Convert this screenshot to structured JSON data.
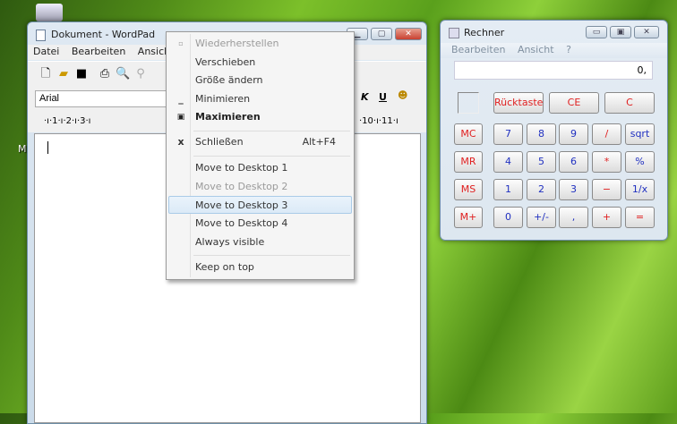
{
  "desktop": {
    "partial_icon_label": "M"
  },
  "wordpad": {
    "title": "Dokument - WordPad",
    "menu": [
      "Datei",
      "Bearbeiten",
      "Ansicht"
    ],
    "font": "Arial",
    "ruler": "·ı·1·ı·2·ı·3·ı",
    "ruler_right": "·10·ı·11·ı"
  },
  "context_menu": {
    "items": [
      {
        "label": "Wiederherstellen",
        "state": "disabled",
        "icon": "restore"
      },
      {
        "label": "Verschieben"
      },
      {
        "label": "Größe ändern"
      },
      {
        "label": "Minimieren",
        "icon": "minimize"
      },
      {
        "label": "Maximieren",
        "bold": true,
        "icon": "maximize"
      },
      {
        "label": "Schließen",
        "shortcut": "Alt+F4",
        "icon": "close"
      },
      {
        "label": "Move to Desktop 1"
      },
      {
        "label": "Move to Desktop 2",
        "state": "disabled"
      },
      {
        "label": "Move to Desktop 3",
        "state": "highlighted"
      },
      {
        "label": "Move to Desktop 4"
      },
      {
        "label": "Always visible"
      },
      {
        "label": "Keep on top"
      }
    ]
  },
  "calculator": {
    "title": "Rechner",
    "menu": [
      "Bearbeiten",
      "Ansicht",
      "?"
    ],
    "display": "0,",
    "top": [
      "Rücktaste",
      "CE",
      "C"
    ],
    "memory": [
      "MC",
      "MR",
      "MS",
      "M+"
    ],
    "rows": [
      [
        "7",
        "8",
        "9",
        "/",
        "sqrt"
      ],
      [
        "4",
        "5",
        "6",
        "*",
        "%"
      ],
      [
        "1",
        "2",
        "3",
        "−",
        "1/x"
      ],
      [
        "0",
        "+/-",
        ",",
        "+",
        "="
      ]
    ]
  }
}
